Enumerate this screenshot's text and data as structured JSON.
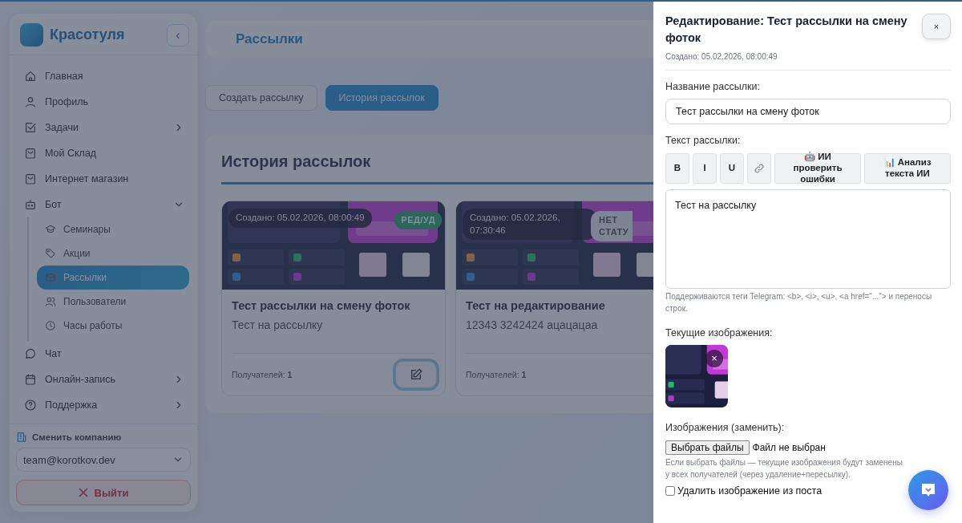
{
  "sidebar": {
    "brand": "Красотуля",
    "collapse": "‹",
    "items": [
      {
        "label": "Главная",
        "selected": false
      },
      {
        "label": "Профиль",
        "selected": false
      },
      {
        "label": "Задачи",
        "selected": false,
        "expanded": false
      },
      {
        "label": "Мой Склад",
        "selected": false
      },
      {
        "label": "Интернет магазин",
        "selected": false
      },
      {
        "label": "Бот",
        "selected": false,
        "expanded": true,
        "children": [
          {
            "label": "Семинары",
            "selected": false
          },
          {
            "label": "Акции",
            "selected": false
          },
          {
            "label": "Рассылки",
            "selected": true
          },
          {
            "label": "Пользователи",
            "selected": false
          },
          {
            "label": "Часы работы",
            "selected": false
          }
        ]
      },
      {
        "label": "Чат",
        "selected": false
      },
      {
        "label": "Онлайн-запись",
        "selected": false,
        "expanded": false
      },
      {
        "label": "Поддержка",
        "selected": false,
        "expanded": false
      }
    ],
    "company_label": "Сменить компанию",
    "company": "team@korotkov.dev",
    "logout": "Выйти"
  },
  "header": {
    "title": "Рассылки"
  },
  "tabs": [
    {
      "label": "Создать рассылку",
      "selected": false
    },
    {
      "label": "История рассылок",
      "selected": true
    }
  ],
  "history": {
    "title": "История рассылок",
    "cards": [
      {
        "created": "Создано: 05.02.2026, 08:00:49",
        "status": {
          "label": "РЕД/УД",
          "kind": "edited"
        },
        "title": "Тест рассылки на смену фоток",
        "text": "Тест на рассылку",
        "recipients": "Получателей: **1**",
        "editable": true
      },
      {
        "created": "Создано: 05.02.2026, 07:30:46",
        "status": {
          "label": "НЕТ СТАТУ",
          "kind": "none"
        },
        "title": "Тест на редактирование",
        "text": "12343 3242424 ацацацаа",
        "recipients": "Получателей: **1**",
        "editable": false
      }
    ]
  },
  "drawer": {
    "title": "Редактирование: Тест рассылки на смену фоток",
    "created": "Создано: 05.02.2026, 08:00:49",
    "close": "×",
    "name_label": "Название рассылки:",
    "name_value": "Тест рассылки на смену фоток",
    "text_label": "Текст рассылки:",
    "toolbar": [
      {
        "kind": "text",
        "label": "B"
      },
      {
        "kind": "text",
        "label": "I"
      },
      {
        "kind": "text",
        "label": "U"
      },
      {
        "kind": "link"
      },
      {
        "kind": "text",
        "label": "🤖 ИИ проверить ошибки"
      },
      {
        "kind": "text",
        "label": "📊 Анализ текста ИИ"
      }
    ],
    "text_value": "Тест на рассылку",
    "text_hint": "Поддерживаются теги Telegram: <b>, <i>, <u>, <a href=\"...\"> и переносы строк.",
    "images_label": "Текущие изображения:",
    "image_remove": "×",
    "replace_label": "Изображения (заменить):",
    "file_button": "Выбрать файлы",
    "file_status": "Файл не выбран",
    "replace_hint": "Если выбрать файлы — текущие изображения будут заменены у всех получателей (через удаление+пересылку).",
    "delete_image": {
      "label": "Удалить изображение из поста",
      "checked": false
    }
  }
}
